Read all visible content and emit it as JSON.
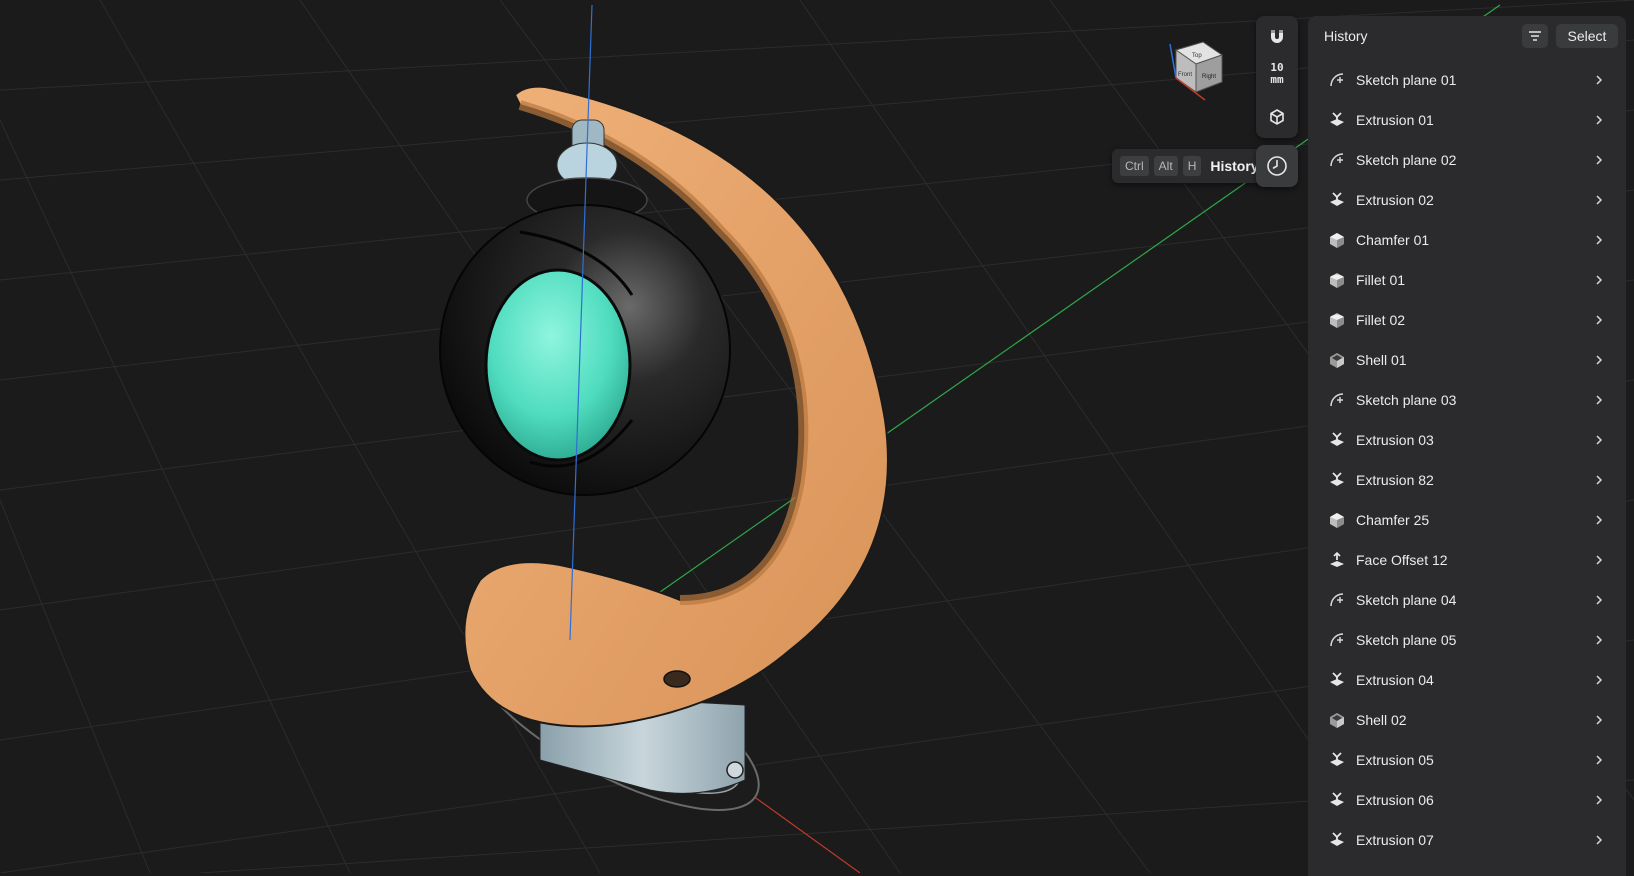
{
  "toolbar": {
    "grid_value": "10",
    "grid_unit": "mm",
    "tooltip": {
      "keys": [
        "Ctrl",
        "Alt",
        "H"
      ],
      "label": "History"
    }
  },
  "view_cube": {
    "faces": [
      "Top",
      "Front",
      "Right"
    ]
  },
  "panel": {
    "title": "History",
    "select_label": "Select",
    "items": [
      {
        "label": "Sketch plane 01",
        "icon": "sketch-plane-icon"
      },
      {
        "label": "Extrusion 01",
        "icon": "extrusion-icon"
      },
      {
        "label": "Sketch plane 02",
        "icon": "sketch-plane-icon"
      },
      {
        "label": "Extrusion 02",
        "icon": "extrusion-icon"
      },
      {
        "label": "Chamfer 01",
        "icon": "chamfer-icon"
      },
      {
        "label": "Fillet 01",
        "icon": "fillet-icon"
      },
      {
        "label": "Fillet 02",
        "icon": "fillet-icon"
      },
      {
        "label": "Shell 01",
        "icon": "shell-icon"
      },
      {
        "label": "Sketch plane 03",
        "icon": "sketch-plane-icon"
      },
      {
        "label": "Extrusion 03",
        "icon": "extrusion-icon"
      },
      {
        "label": "Extrusion 82",
        "icon": "extrusion-icon"
      },
      {
        "label": "Chamfer 25",
        "icon": "chamfer-icon"
      },
      {
        "label": "Face Offset 12",
        "icon": "face-offset-icon"
      },
      {
        "label": "Sketch plane 04",
        "icon": "sketch-plane-icon"
      },
      {
        "label": "Sketch plane 05",
        "icon": "sketch-plane-icon"
      },
      {
        "label": "Extrusion 04",
        "icon": "extrusion-icon"
      },
      {
        "label": "Shell 02",
        "icon": "shell-icon"
      },
      {
        "label": "Extrusion 05",
        "icon": "extrusion-icon"
      },
      {
        "label": "Extrusion 06",
        "icon": "extrusion-icon"
      },
      {
        "label": "Extrusion 07",
        "icon": "extrusion-icon"
      }
    ]
  },
  "colors": {
    "background": "#1b1b1c",
    "panel": "#2b2b2d",
    "wood": "#e8a66c",
    "globe": "#5fe6c9",
    "shell": "#111111",
    "axis_x": "#c0392b",
    "axis_y": "#2ea84a",
    "axis_z": "#2f6fd6"
  }
}
